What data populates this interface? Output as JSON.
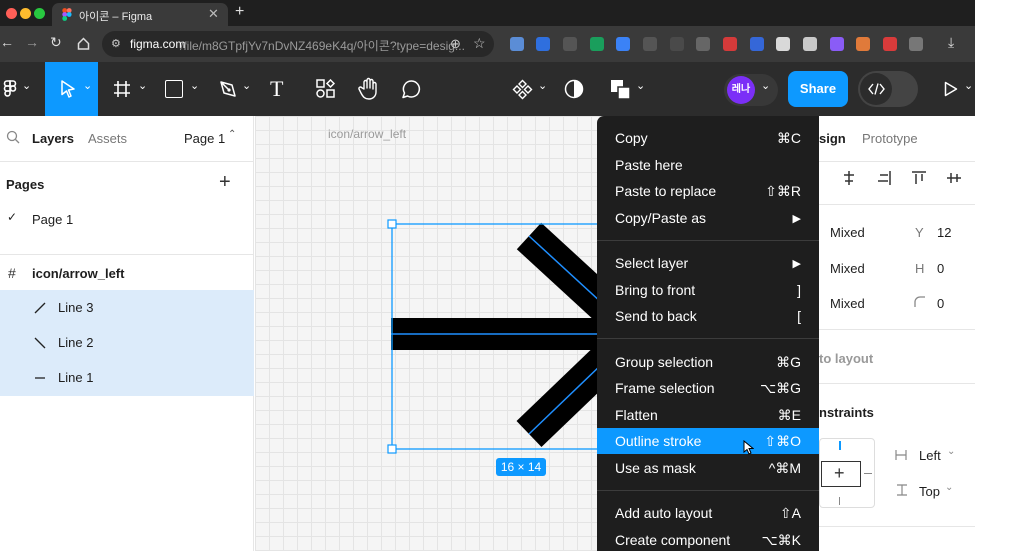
{
  "browser": {
    "tab_title": "아이콘 – Figma",
    "url_host": "figma.com",
    "url_path": "/file/m8GTpfjYv7nDvNZ469eK4q/아이콘?type=desig..."
  },
  "toolbar": {
    "share_label": "Share",
    "avatar_text": "레나"
  },
  "left_panel": {
    "tab_layers": "Layers",
    "tab_assets": "Assets",
    "page_selector": "Page 1",
    "pages_heading": "Pages",
    "pages": [
      {
        "label": "Page 1"
      }
    ],
    "frame_name": "icon/arrow_left",
    "layers": [
      {
        "label": "Line 3"
      },
      {
        "label": "Line 2"
      },
      {
        "label": "Line 1"
      }
    ]
  },
  "canvas": {
    "frame_label": "icon/arrow_left",
    "size_badge": "16 × 14"
  },
  "context_menu": {
    "groups": [
      [
        {
          "label": "Copy",
          "shortcut": "⌘C"
        },
        {
          "label": "Paste here",
          "shortcut": ""
        },
        {
          "label": "Paste to replace",
          "shortcut": "⇧⌘R"
        },
        {
          "label": "Copy/Paste as",
          "shortcut": "▶"
        }
      ],
      [
        {
          "label": "Select layer",
          "shortcut": "▶"
        },
        {
          "label": "Bring to front",
          "shortcut": "]"
        },
        {
          "label": "Send to back",
          "shortcut": "["
        }
      ],
      [
        {
          "label": "Group selection",
          "shortcut": "⌘G"
        },
        {
          "label": "Frame selection",
          "shortcut": "⌥⌘G"
        },
        {
          "label": "Flatten",
          "shortcut": "⌘E"
        },
        {
          "label": "Outline stroke",
          "shortcut": "⇧⌘O"
        },
        {
          "label": "Use as mask",
          "shortcut": "^⌘M"
        }
      ],
      [
        {
          "label": "Add auto layout",
          "shortcut": "⇧A"
        },
        {
          "label": "Create component",
          "shortcut": "⌥⌘K"
        }
      ]
    ],
    "highlighted": "Outline stroke"
  },
  "right_panel": {
    "tab_design": "sign",
    "tab_prototype": "Prototype",
    "props": [
      {
        "left_val": "Mixed",
        "right_label": "Y",
        "right_val": "12"
      },
      {
        "left_val": "Mixed",
        "right_label": "H",
        "right_val": "0"
      },
      {
        "left_val": "Mixed",
        "right_label": "",
        "right_val": "0"
      }
    ],
    "auto_layout_text": "to layout",
    "constraints_heading": "nstraints",
    "constraint_h": "Left",
    "constraint_v": "Top"
  },
  "colors": {
    "accent": "#0d99ff",
    "toolbar_bg": "#2c2c2c",
    "menu_bg": "#1e1e1e",
    "selection_bg": "#dcebfa",
    "avatar": "#7b2ff7"
  }
}
